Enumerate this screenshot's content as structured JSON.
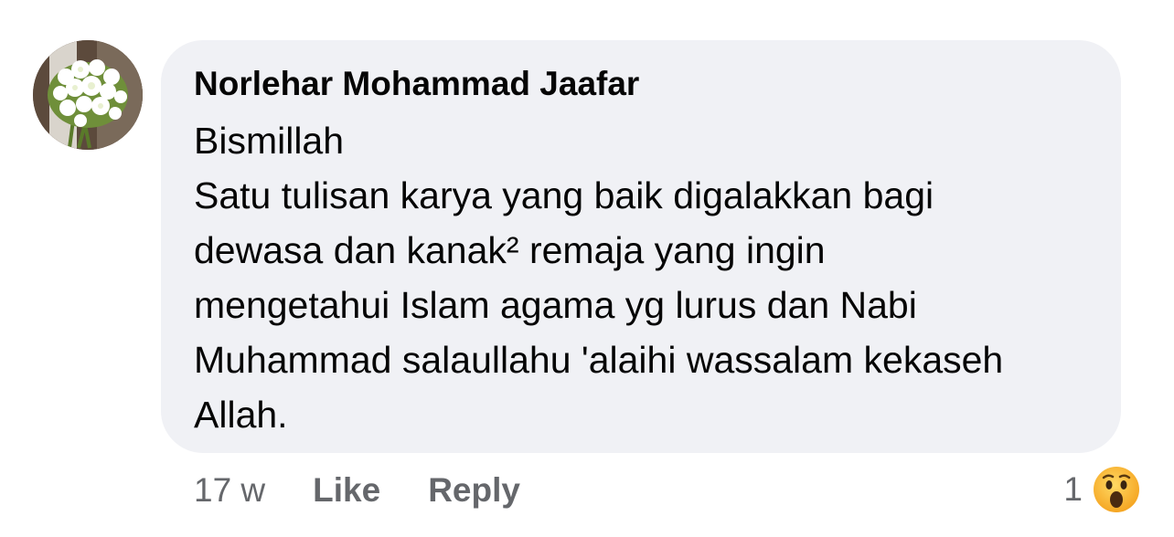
{
  "comment": {
    "author": "Norlehar Mohammad Jaafar",
    "lines": [
      "Bismillah",
      "Satu tulisan karya yang baik digalakkan bagi",
      "dewasa dan kanak² remaja yang ingin",
      "mengetahui Islam agama yg lurus dan Nabi",
      "Muhammad salaullahu 'alaihi wassalam kekaseh",
      "Allah."
    ],
    "timestamp": "17 w",
    "like_label": "Like",
    "reply_label": "Reply",
    "reaction_count": "1",
    "reaction_icon": "wow-emoji-icon",
    "avatar": "white-flower-bouquet-avatar"
  },
  "colors": {
    "bubble": "#f0f1f5",
    "text": "#050505",
    "meta": "#65676b",
    "wow": "#f7b125"
  }
}
